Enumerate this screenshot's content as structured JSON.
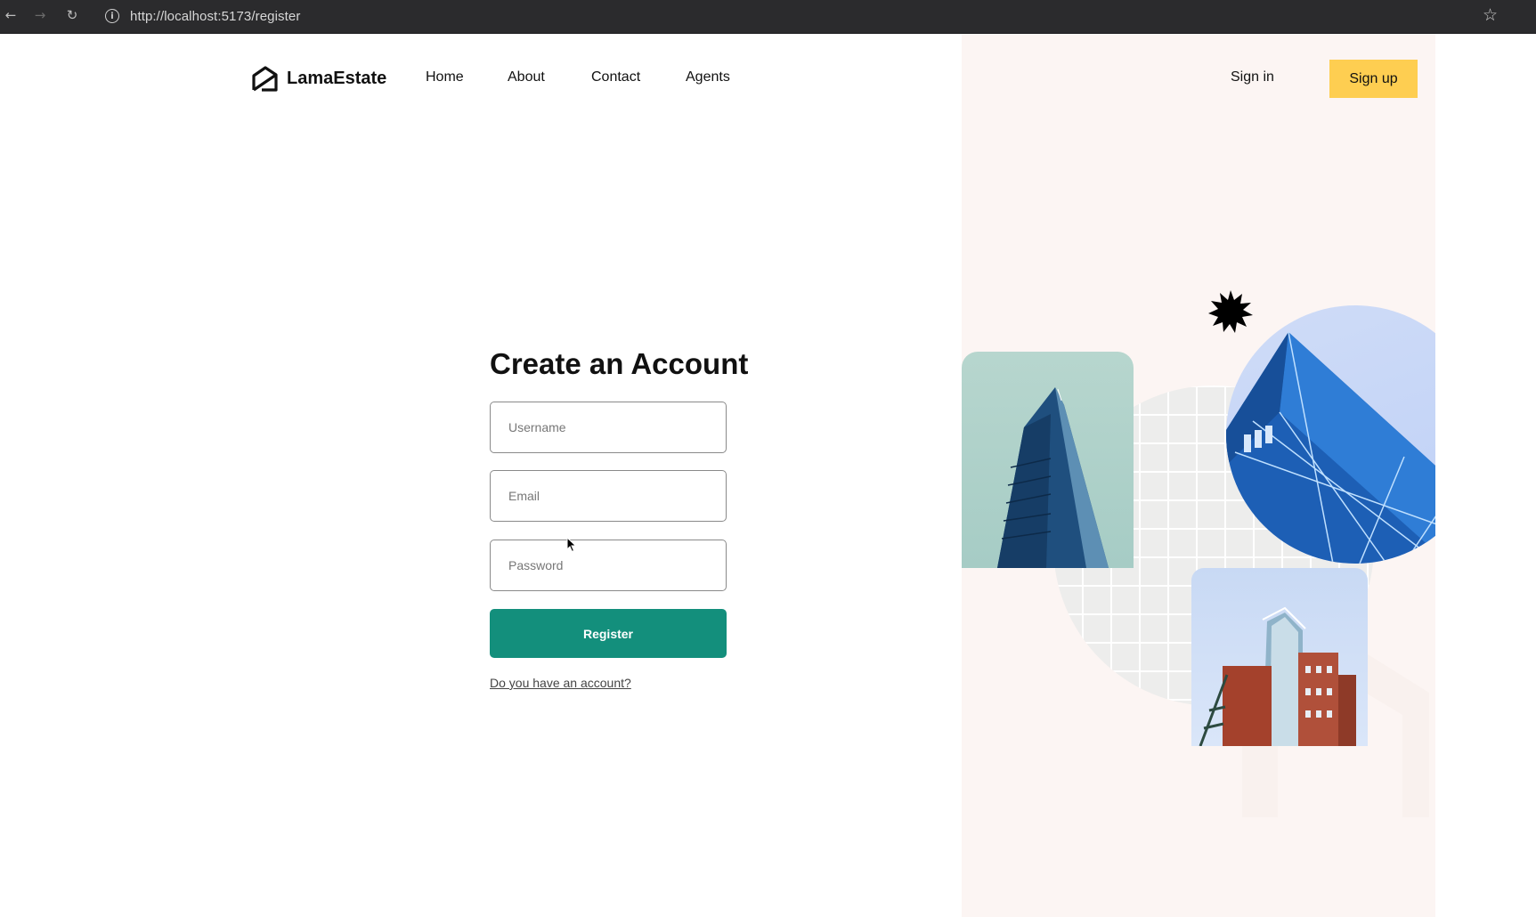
{
  "browser": {
    "url": "http://localhost:5173/register",
    "back_icon": "arrow-left-icon",
    "forward_icon": "arrow-right-icon",
    "reload_icon": "reload-icon",
    "info_icon": "info-icon",
    "bookmark_icon": "star-icon"
  },
  "navbar": {
    "brand": "LamaEstate",
    "links": [
      "Home",
      "About",
      "Contact",
      "Agents"
    ],
    "signin": "Sign in",
    "signup": "Sign up"
  },
  "form": {
    "title": "Create an Account",
    "username_placeholder": "Username",
    "email_placeholder": "Email",
    "password_placeholder": "Password",
    "submit_label": "Register",
    "login_link": "Do you have an account?"
  },
  "colors": {
    "accent": "#138f7c",
    "signup_bg": "#fece51",
    "panel_bg": "#fcf5f3"
  }
}
